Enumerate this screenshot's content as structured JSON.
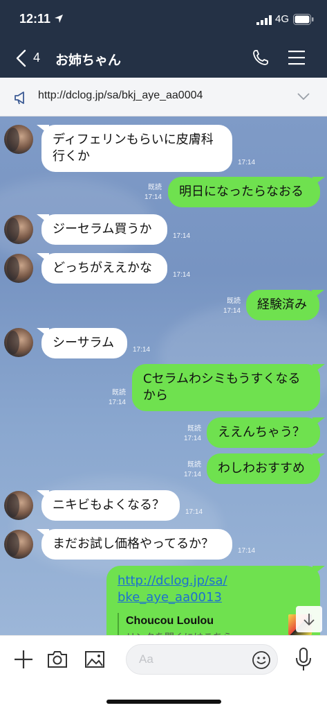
{
  "status": {
    "time": "12:11",
    "network": "4G"
  },
  "header": {
    "back_count": "4",
    "title": "お姉ちゃん"
  },
  "announcement": {
    "text": "http://dclog.jp/sa/bkj_aye_aa0004"
  },
  "messages": [
    {
      "side": "in",
      "text": "ディフェリンもらいに皮膚科行くか",
      "time": "17:14"
    },
    {
      "side": "out",
      "text": "明日になったらなおる",
      "read": "既読",
      "time": "17:14"
    },
    {
      "side": "in",
      "text": "ジーセラム買うか",
      "time": "17:14"
    },
    {
      "side": "in",
      "text": "どっちがええかな",
      "time": "17:14"
    },
    {
      "side": "out",
      "text": "経験済み",
      "read": "既読",
      "time": "17:14"
    },
    {
      "side": "in",
      "text": "シーサラム",
      "time": "17:14"
    },
    {
      "side": "out",
      "text": "Cセラムわシミもうすくなるから",
      "read": "既読",
      "time": "17:14"
    },
    {
      "side": "out",
      "text": "ええんちゃう？",
      "read": "既読",
      "time": "17:14"
    },
    {
      "side": "out",
      "text": "わしわおすすめ",
      "read": "既読",
      "time": "17:14"
    },
    {
      "side": "in",
      "text": "ニキビもよくなる？",
      "time": "17:14"
    },
    {
      "side": "in",
      "text": "まだお試し価格やってるか？",
      "time": "17:14"
    }
  ],
  "link_message": {
    "url_line1": "http://dclog.jp/sa/",
    "url_line2": "bke_aye_aa0013",
    "preview_title": "Choucou Loulou",
    "preview_desc": "リンクを開くにはこちら"
  },
  "input": {
    "placeholder": "Aa"
  },
  "icons": {
    "back": "chevron-left-icon",
    "phone": "phone-icon",
    "menu": "hamburger-menu-icon",
    "announce": "megaphone-icon",
    "expand": "chevron-down-icon",
    "add": "plus-icon",
    "camera": "camera-icon",
    "image": "image-icon",
    "emoji": "emoji-icon",
    "mic": "microphone-icon",
    "scroll": "arrow-down-icon"
  },
  "colors": {
    "header_bg": "#243145",
    "out_bubble": "#6fe14f",
    "in_bubble": "#ffffff",
    "chat_bg": "#7f9bc7",
    "link": "#1d6fd1"
  }
}
